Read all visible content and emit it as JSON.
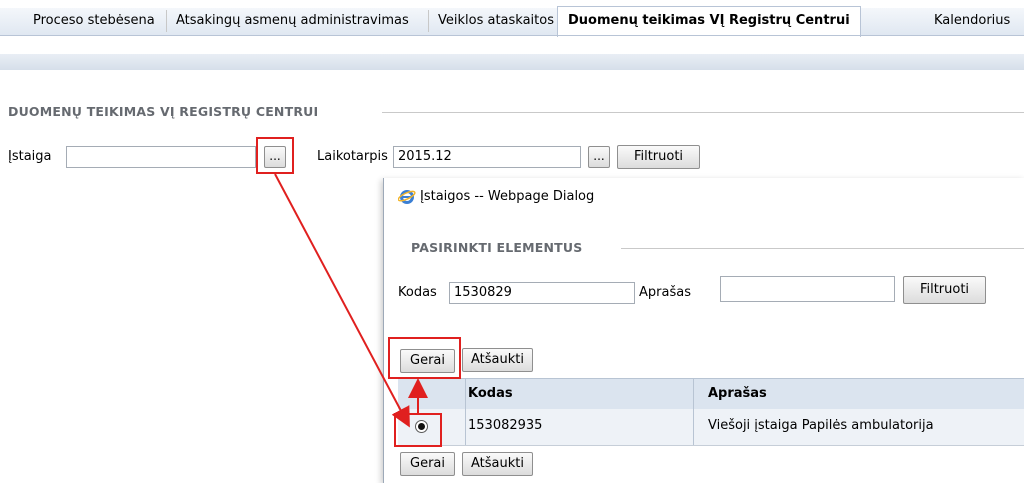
{
  "tabs": [
    {
      "label": "Proceso stebėsena"
    },
    {
      "label": "Atsakingų asmenų administravimas"
    },
    {
      "label": "Veiklos ataskaitos"
    },
    {
      "label": "Duomenų teikimas VĮ Registrų Centrui"
    },
    {
      "label": "Kalendorius"
    }
  ],
  "section": {
    "title": "DUOMENŲ TEIKIMAS VĮ REGISTRŲ CENTRUI",
    "istaiga_label": "Įstaiga",
    "istaiga_value": "",
    "browse_label": "...",
    "period_label": "Laikotarpis",
    "period_value": "2015.12",
    "period_browse_label": "...",
    "filter_label": "Filtruoti"
  },
  "dialog": {
    "title": "Įstaigos -- Webpage Dialog",
    "fieldset_title": "PASIRINKTI ELEMENTUS",
    "code_label": "Kodas",
    "code_value": "1530829",
    "desc_label": "Aprašas",
    "desc_value": "",
    "filter_label": "Filtruoti",
    "ok_label": "Gerai",
    "cancel_label": "Atšaukti",
    "columns": [
      "Kodas",
      "Aprašas"
    ],
    "rows": [
      {
        "code": "153082935",
        "description": "Viešoji įstaiga Papilės ambulatorija",
        "selected": true
      }
    ]
  },
  "colors": {
    "highlight": "#e0201f",
    "grid_header": "#dbe4ef"
  }
}
